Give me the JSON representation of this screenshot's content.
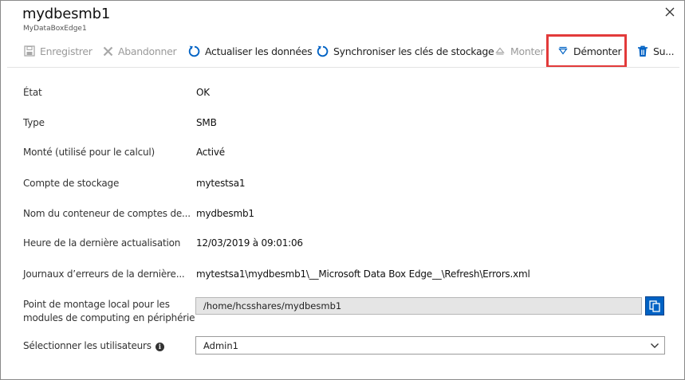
{
  "header": {
    "title": "mydbesmb1",
    "subtitle": "MyDataBoxEdge1"
  },
  "toolbar": {
    "save_label": "Enregistrer",
    "discard_label": "Abandonner",
    "refresh_label": "Actualiser les données",
    "sync_keys_label": "Synchroniser les clés de stockage",
    "mount_label": "Monter",
    "unmount_label": "Démonter",
    "delete_label": "Su..."
  },
  "details": {
    "state_label": "État",
    "state_value": "OK",
    "type_label": "Type",
    "type_value": "SMB",
    "mounted_label": "Monté (utilisé pour le calcul)",
    "mounted_value": "Activé",
    "storage_account_label": "Compte de stockage",
    "storage_account_value": "mytestsa1",
    "container_label": "Nom du conteneur de comptes de...",
    "container_value": "mydbesmb1",
    "last_refresh_label": "Heure de la dernière actualisation",
    "last_refresh_value": "12/03/2019 à 09:01:06",
    "error_logs_label": "Journaux d’erreurs de la dernière...",
    "error_logs_value": "mytestsa1\\mydbesmb1\\__Microsoft Data Box Edge__\\Refresh\\Errors.xml",
    "mount_point_label_line1": "Point de montage local pour les",
    "mount_point_label_line2": "modules de computing en périphérie",
    "mount_point_value": "/home/hcsshares/mydbesmb1",
    "users_label": "Sélectionner les utilisateurs",
    "users_value": "Admin1"
  },
  "colors": {
    "accent": "#0062c4",
    "highlight": "#e23a3a",
    "disabled": "#9a9a9a"
  }
}
